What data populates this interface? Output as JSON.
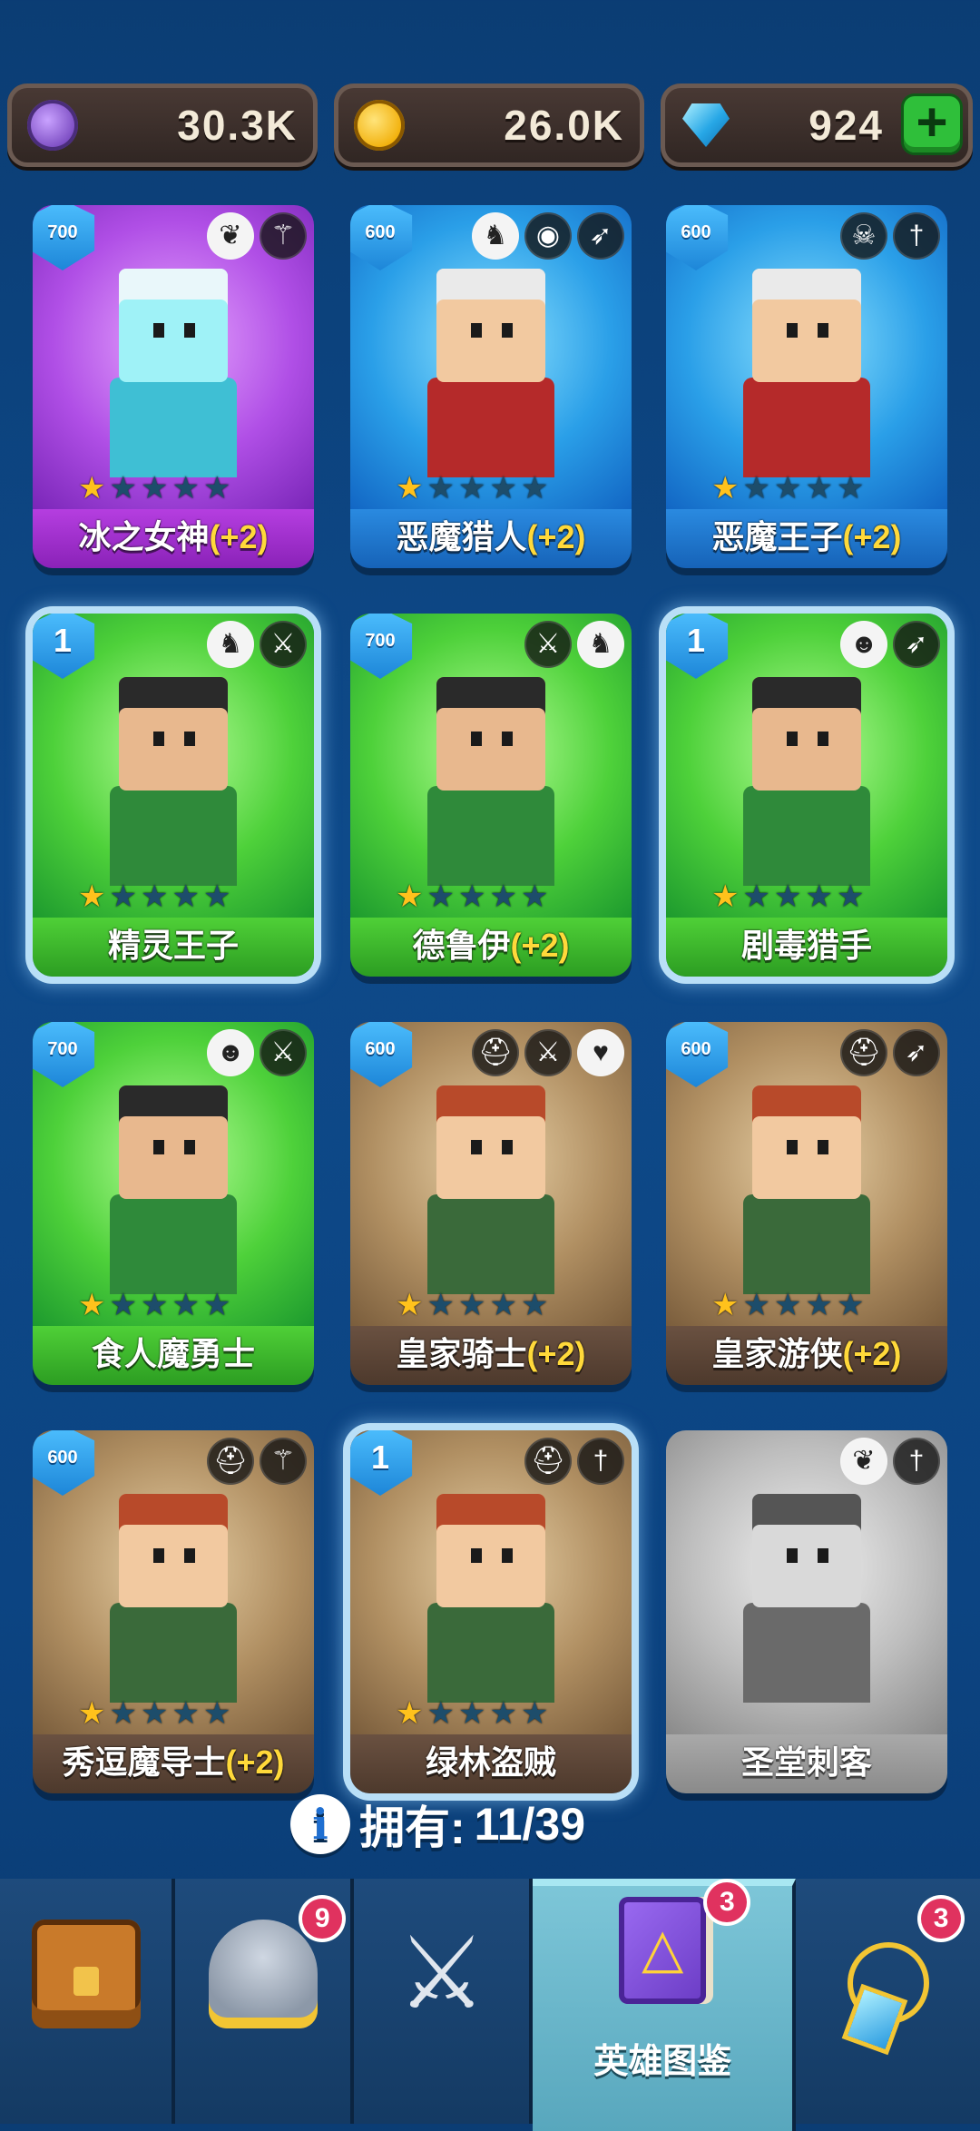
{
  "currency": {
    "purple": {
      "icon": "purple-coin-icon",
      "value": "30.3K"
    },
    "gold": {
      "icon": "gold-coin-icon",
      "value": "26.0K"
    },
    "gems": {
      "icon": "gem-icon",
      "value": "924",
      "add_label": "+"
    }
  },
  "heroes": [
    {
      "name": "冰之女神",
      "bonus": "(+2)",
      "badge": "700",
      "rarity": "purple",
      "stars": 1,
      "classes": [
        "wings-icon",
        "wand-icon"
      ]
    },
    {
      "name": "恶魔猎人",
      "bonus": "(+2)",
      "badge": "600",
      "rarity": "blue",
      "stars": 1,
      "classes": [
        "elf-icon",
        "eye-icon",
        "bow-icon"
      ]
    },
    {
      "name": "恶魔王子",
      "bonus": "(+2)",
      "badge": "600",
      "rarity": "blue",
      "stars": 1,
      "classes": [
        "skull-icon",
        "dagger-icon"
      ]
    },
    {
      "name": "精灵王子",
      "bonus": "",
      "badge": "1",
      "rarity": "green",
      "stars": 1,
      "classes": [
        "elf-icon",
        "sword-icon"
      ]
    },
    {
      "name": "德鲁伊",
      "bonus": "(+2)",
      "badge": "700",
      "rarity": "green",
      "stars": 1,
      "classes": [
        "sword-icon",
        "elf-icon"
      ]
    },
    {
      "name": "剧毒猎手",
      "bonus": "",
      "badge": "1",
      "rarity": "green",
      "stars": 1,
      "classes": [
        "orc-icon",
        "bow-icon"
      ]
    },
    {
      "name": "食人魔勇士",
      "bonus": "",
      "badge": "700",
      "rarity": "green",
      "stars": 1,
      "classes": [
        "orc-icon",
        "sword-icon"
      ]
    },
    {
      "name": "皇家骑士",
      "bonus": "(+2)",
      "badge": "600",
      "rarity": "brown",
      "stars": 1,
      "classes": [
        "helmet-icon",
        "sword-icon",
        "heart-icon"
      ]
    },
    {
      "name": "皇家游侠",
      "bonus": "(+2)",
      "badge": "600",
      "rarity": "brown",
      "stars": 1,
      "classes": [
        "helmet-icon",
        "bow-icon"
      ]
    },
    {
      "name": "秀逗魔导士",
      "bonus": "(+2)",
      "badge": "600",
      "rarity": "brown",
      "stars": 1,
      "classes": [
        "helmet-icon",
        "wand-icon"
      ]
    },
    {
      "name": "绿林盗贼",
      "bonus": "",
      "badge": "1",
      "rarity": "brown",
      "stars": 1,
      "classes": [
        "helmet-icon",
        "dagger-icon"
      ]
    },
    {
      "name": "圣堂刺客",
      "bonus": "",
      "badge": "",
      "rarity": "gray",
      "stars": 0,
      "classes": [
        "wings-icon",
        "dagger-icon"
      ]
    }
  ],
  "owned": {
    "label": "拥有:",
    "value": "11/39"
  },
  "nav": [
    {
      "name": "chest",
      "icon": "chest-icon",
      "label": "",
      "notif": ""
    },
    {
      "name": "heroes",
      "icon": "winged-helmet-icon",
      "label": "",
      "notif": "9"
    },
    {
      "name": "battle",
      "icon": "crossed-swords-icon",
      "label": "",
      "notif": ""
    },
    {
      "name": "codex",
      "icon": "spellbook-icon",
      "label": "英雄图鉴",
      "notif": "3"
    },
    {
      "name": "equipment",
      "icon": "amulet-icon",
      "label": "",
      "notif": "3"
    }
  ]
}
